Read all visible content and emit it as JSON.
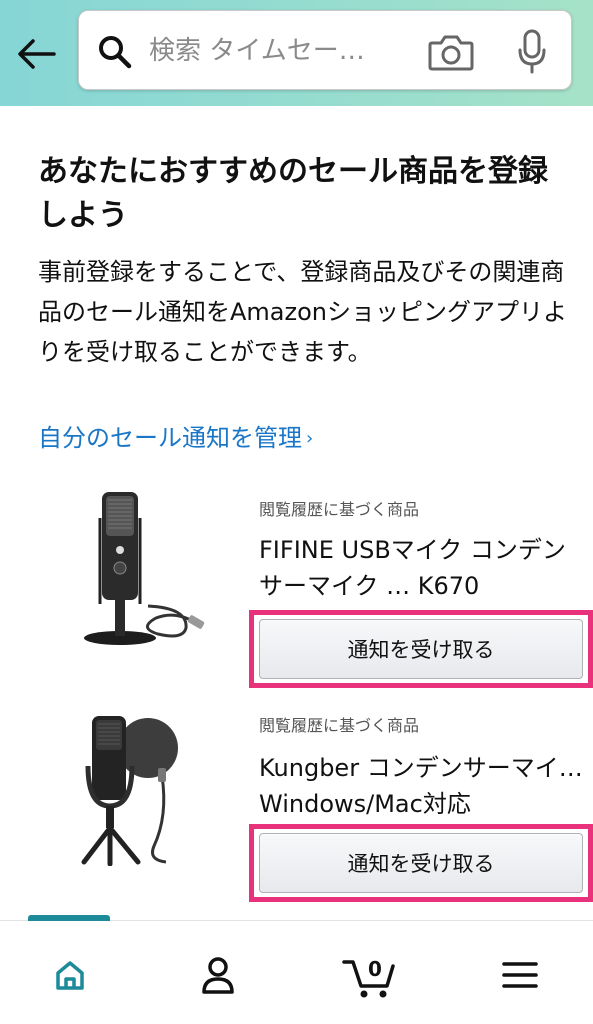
{
  "header": {
    "search_placeholder": "検索 タイムセー…"
  },
  "main": {
    "title": "あなたにおすすめのセール商品を登録しよう",
    "description": "事前登録をすることで、登録商品及びその関連商品のセール通知をAmazonショッピングアプリよりを受け取ることができます。",
    "manage_link": "自分のセール通知を管理",
    "manage_chevron": "›"
  },
  "products": [
    {
      "category": "閲覧履歴に基づく商品",
      "name": "FIFINE USBマイク コンデンサーマイク … K670",
      "button": "通知を受け取る"
    },
    {
      "category": "閲覧履歴に基づく商品",
      "name": "Kungber コンデンサーマイ… Windows/Mac対応",
      "button": "通知を受け取る"
    }
  ],
  "bottom_nav": {
    "cart_count": "0",
    "items": [
      "home-icon",
      "account-icon",
      "cart-icon",
      "menu-icon"
    ]
  },
  "colors": {
    "header_gradient_start": "#86d6d6",
    "header_gradient_end": "#a6e2c8",
    "link": "#1a76c7",
    "highlight": "#e8327c",
    "active_nav": "#1c8a98"
  }
}
